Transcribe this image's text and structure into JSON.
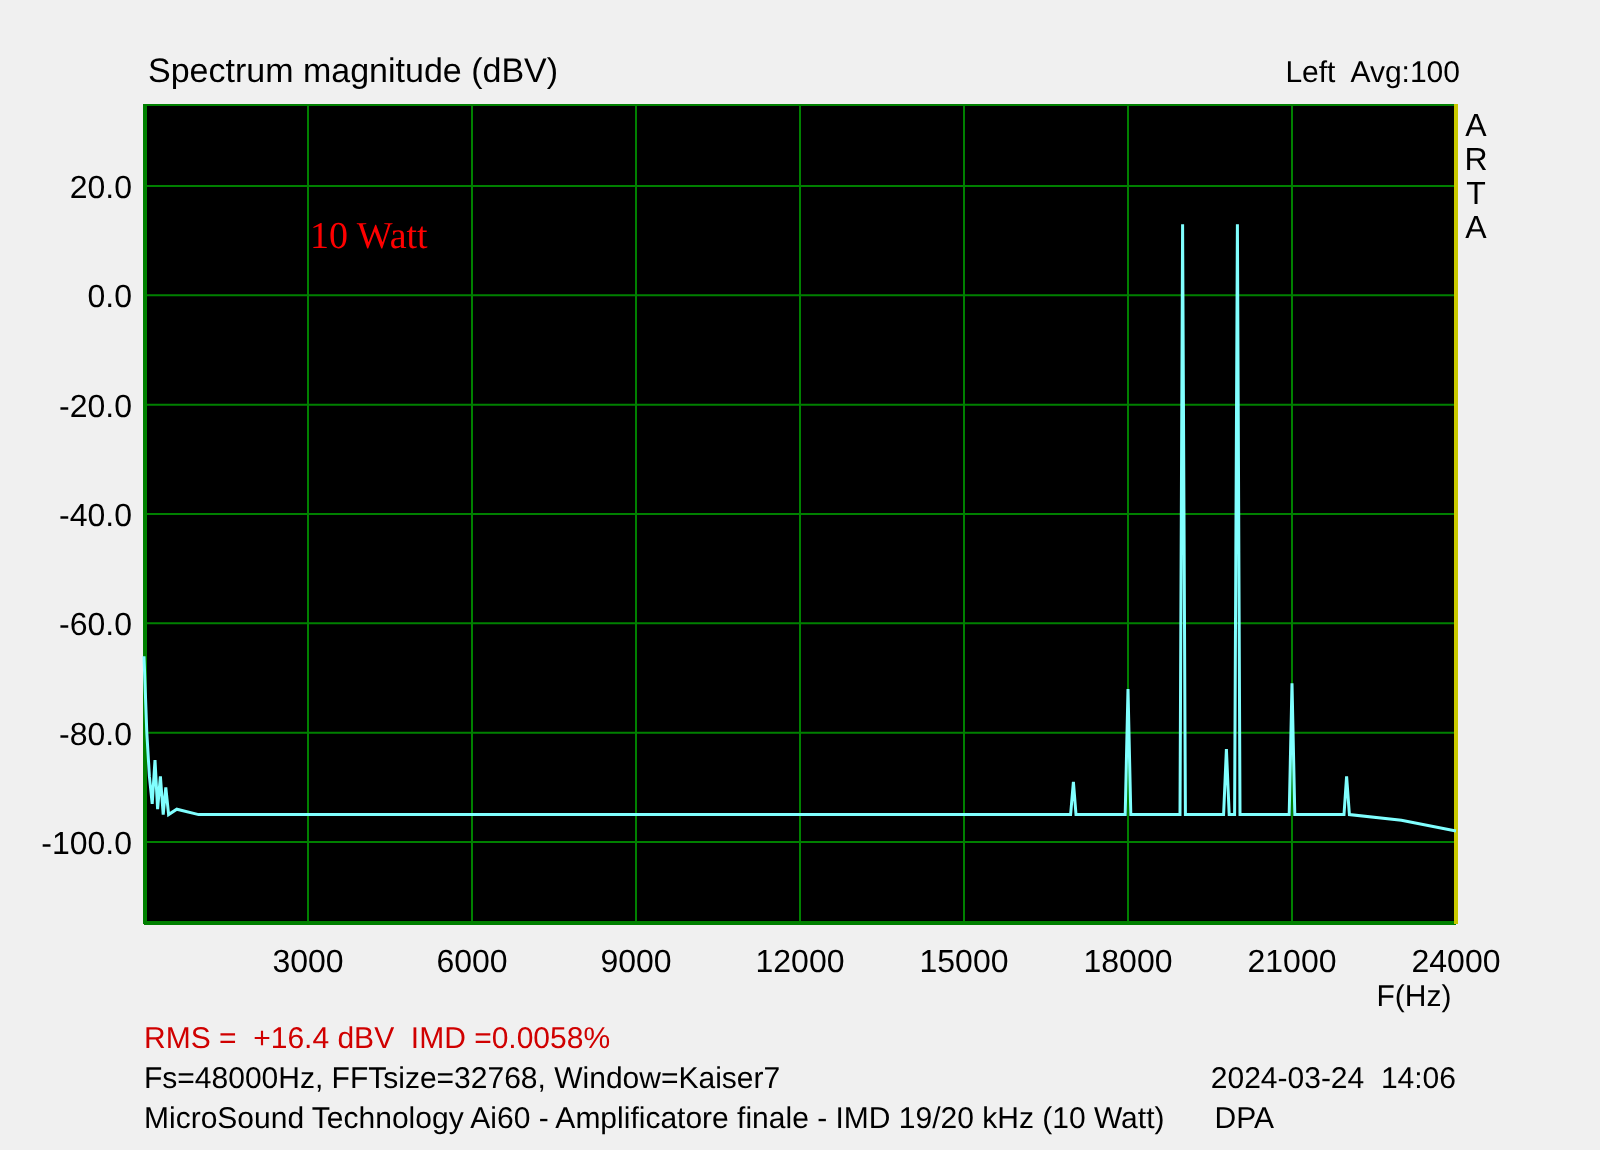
{
  "chart": {
    "title": "Spectrum magnitude (dBV)",
    "channel_info": "Left  Avg:100",
    "side_letters": [
      "A",
      "R",
      "T",
      "A"
    ],
    "annotation": "10 Watt",
    "chart_data": {
      "type": "line",
      "grid": true,
      "xlabel": "F(Hz)",
      "xlim": [
        0,
        24000
      ],
      "ylim": [
        -115,
        35
      ],
      "xticks": [
        3000,
        6000,
        9000,
        12000,
        15000,
        18000,
        21000,
        24000
      ],
      "yticks": [
        {
          "value": 20,
          "label": "20.0"
        },
        {
          "value": 0,
          "label": "0.0"
        },
        {
          "value": -20,
          "label": "-20.0"
        },
        {
          "value": -40,
          "label": "-40.0"
        },
        {
          "value": -60,
          "label": "-60.0"
        },
        {
          "value": -80,
          "label": "-80.0"
        },
        {
          "value": -100,
          "label": "-100.0"
        }
      ],
      "x": [
        0,
        50,
        100,
        150,
        200,
        250,
        300,
        350,
        400,
        450,
        600,
        1000,
        3000,
        6000,
        9000,
        12000,
        15000,
        16950,
        17000,
        17050,
        17950,
        18000,
        18050,
        18950,
        19000,
        19050,
        19750,
        19800,
        19850,
        19950,
        20000,
        20050,
        20950,
        21000,
        21050,
        21950,
        22000,
        22050,
        23000,
        24000
      ],
      "series": [
        {
          "color": "#80ffff",
          "values": [
            -66,
            -80,
            -88,
            -93,
            -85,
            -94,
            -88,
            -95,
            -90,
            -95,
            -94,
            -95,
            -95,
            -95,
            -95,
            -95,
            -95,
            -95,
            -89,
            -95,
            -95,
            -72,
            -95,
            -95,
            13,
            -95,
            -95,
            -83,
            -95,
            -95,
            13,
            -95,
            -95,
            -71,
            -95,
            -95,
            -88,
            -95,
            -96,
            -98
          ]
        }
      ]
    }
  },
  "footer": {
    "measurement": "RMS =  +16.4 dBV  IMD =0.0058%",
    "settings": "Fs=48000Hz, FFTsize=32768, Window=Kaiser7",
    "timestamp": "2024-03-24  14:06",
    "description": "MicroSound Technology Ai60 - Amplificatore finale - IMD 19/20 kHz (10 Watt)",
    "tag": "DPA"
  }
}
